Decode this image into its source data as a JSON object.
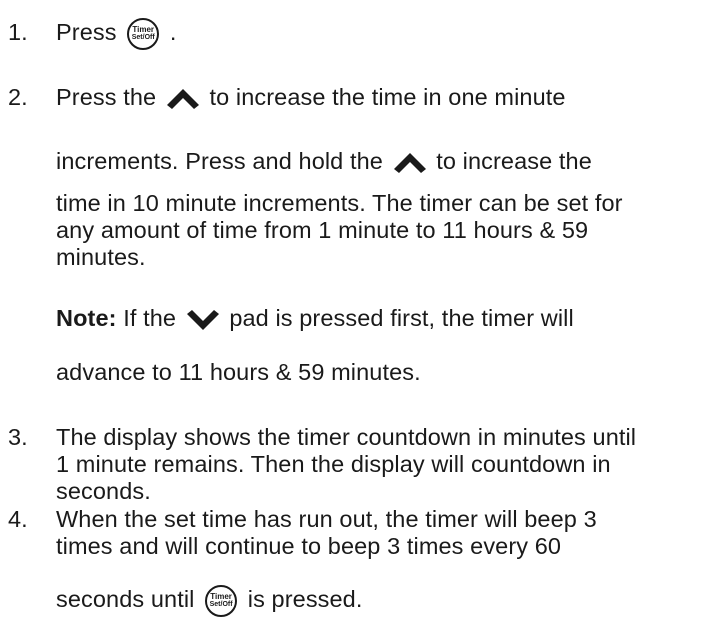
{
  "button_label": {
    "line1": "Timer",
    "line2": "Set/Off"
  },
  "steps": [
    {
      "num": "1.",
      "before": "Press",
      "after": "."
    },
    {
      "num": "2.",
      "a": "Press the",
      "b": "to increase the time in one minute",
      "c": "increments. Press and hold the",
      "d": "to increase the",
      "e": "time in 10 minute increments. The timer can be set for",
      "f": "any amount of time from 1 minute to 11 hours & 59",
      "g": "minutes."
    },
    {
      "num": "3.",
      "l1": "The display shows the timer countdown in minutes until",
      "l2": "1 minute remains. Then the display will countdown in",
      "l3": "seconds."
    },
    {
      "num": "4.",
      "l1": "When the set time has run out, the timer will beep 3",
      "l2": "times and will continue to beep 3 times every 60",
      "l3a": "seconds until",
      "l3b": "is pressed."
    }
  ],
  "note": {
    "label": "Note:",
    "a": "If the",
    "b": "pad is pressed first, the timer will",
    "c": "advance to 11 hours & 59 minutes."
  },
  "icons": {
    "up": "up-arrow-icon",
    "down": "down-arrow-icon",
    "button": "timer-set-off-button-icon"
  }
}
